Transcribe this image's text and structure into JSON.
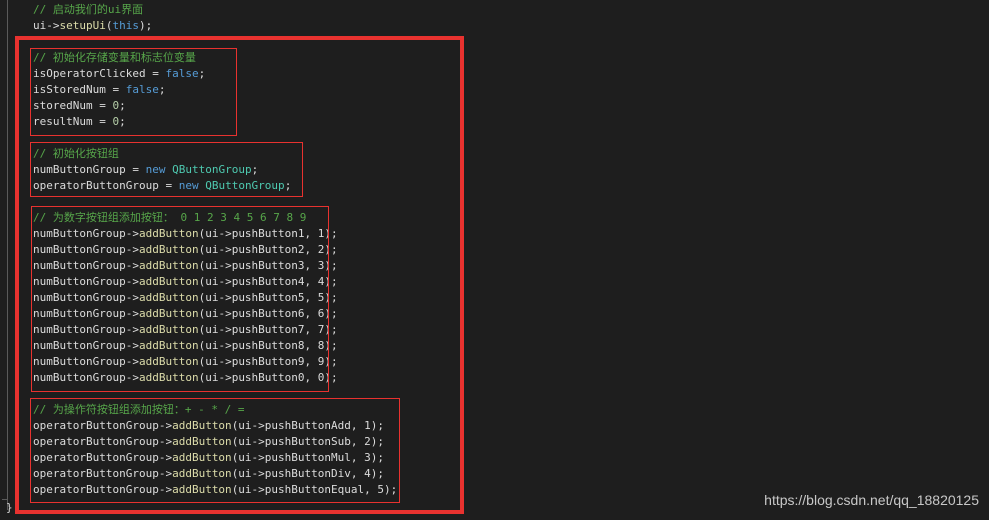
{
  "code": {
    "header": {
      "comment": "// 启动我们的ui界面",
      "setup": {
        "obj": "ui->",
        "fn": "setupUi",
        "open": "(",
        "arg": "this",
        "close": ");"
      }
    },
    "block1": {
      "comment": "// 初始化存储变量和标志位变量",
      "lines": [
        {
          "lhs": "isOperatorClicked = ",
          "val": "false",
          "end": ";"
        },
        {
          "lhs": "isStoredNum = ",
          "val": "false",
          "end": ";"
        },
        {
          "lhs": "storedNum = ",
          "val": "0",
          "end": ";"
        },
        {
          "lhs": "resultNum = ",
          "val": "0",
          "end": ";"
        }
      ]
    },
    "block2": {
      "comment": "// 初始化按钮组",
      "lines": [
        {
          "lhs": "numButtonGroup = ",
          "kw": "new",
          "type": "QButtonGroup",
          "end": ";"
        },
        {
          "lhs": "operatorButtonGroup = ",
          "kw": "new",
          "type": "QButtonGroup",
          "end": ";"
        }
      ]
    },
    "block3": {
      "comment": "// 为数字按钮组添加按钮： 0 1 2 3 4 5 6 7 8 9",
      "lines": [
        {
          "obj": "numButtonGroup->",
          "fn": "addButton",
          "args": "(ui->pushButton1, 1);"
        },
        {
          "obj": "numButtonGroup->",
          "fn": "addButton",
          "args": "(ui->pushButton2, 2);"
        },
        {
          "obj": "numButtonGroup->",
          "fn": "addButton",
          "args": "(ui->pushButton3, 3);"
        },
        {
          "obj": "numButtonGroup->",
          "fn": "addButton",
          "args": "(ui->pushButton4, 4);"
        },
        {
          "obj": "numButtonGroup->",
          "fn": "addButton",
          "args": "(ui->pushButton5, 5);"
        },
        {
          "obj": "numButtonGroup->",
          "fn": "addButton",
          "args": "(ui->pushButton6, 6);"
        },
        {
          "obj": "numButtonGroup->",
          "fn": "addButton",
          "args": "(ui->pushButton7, 7);"
        },
        {
          "obj": "numButtonGroup->",
          "fn": "addButton",
          "args": "(ui->pushButton8, 8);"
        },
        {
          "obj": "numButtonGroup->",
          "fn": "addButton",
          "args": "(ui->pushButton9, 9);"
        },
        {
          "obj": "numButtonGroup->",
          "fn": "addButton",
          "args": "(ui->pushButton0, 0);"
        }
      ]
    },
    "block4": {
      "comment": "// 为操作符按钮组添加按钮：+ - * / =",
      "lines": [
        {
          "obj": "operatorButtonGroup->",
          "fn": "addButton",
          "args": "(ui->pushButtonAdd, 1);"
        },
        {
          "obj": "operatorButtonGroup->",
          "fn": "addButton",
          "args": "(ui->pushButtonSub, 2);"
        },
        {
          "obj": "operatorButtonGroup->",
          "fn": "addButton",
          "args": "(ui->pushButtonMul, 3);"
        },
        {
          "obj": "operatorButtonGroup->",
          "fn": "addButton",
          "args": "(ui->pushButtonDiv, 4);"
        },
        {
          "obj": "operatorButtonGroup->",
          "fn": "addButton",
          "args": "(ui->pushButtonEqual, 5);"
        }
      ]
    },
    "closing_brace": "}"
  },
  "watermark": "https://blog.csdn.net/qq_18820125",
  "colors": {
    "background": "#1e1e1e",
    "comment": "#57a64a",
    "keyword": "#569cd6",
    "type": "#4ec9b0",
    "function": "#dcdcaa",
    "text": "#dcdcdc",
    "highlight": "#e8322f"
  }
}
